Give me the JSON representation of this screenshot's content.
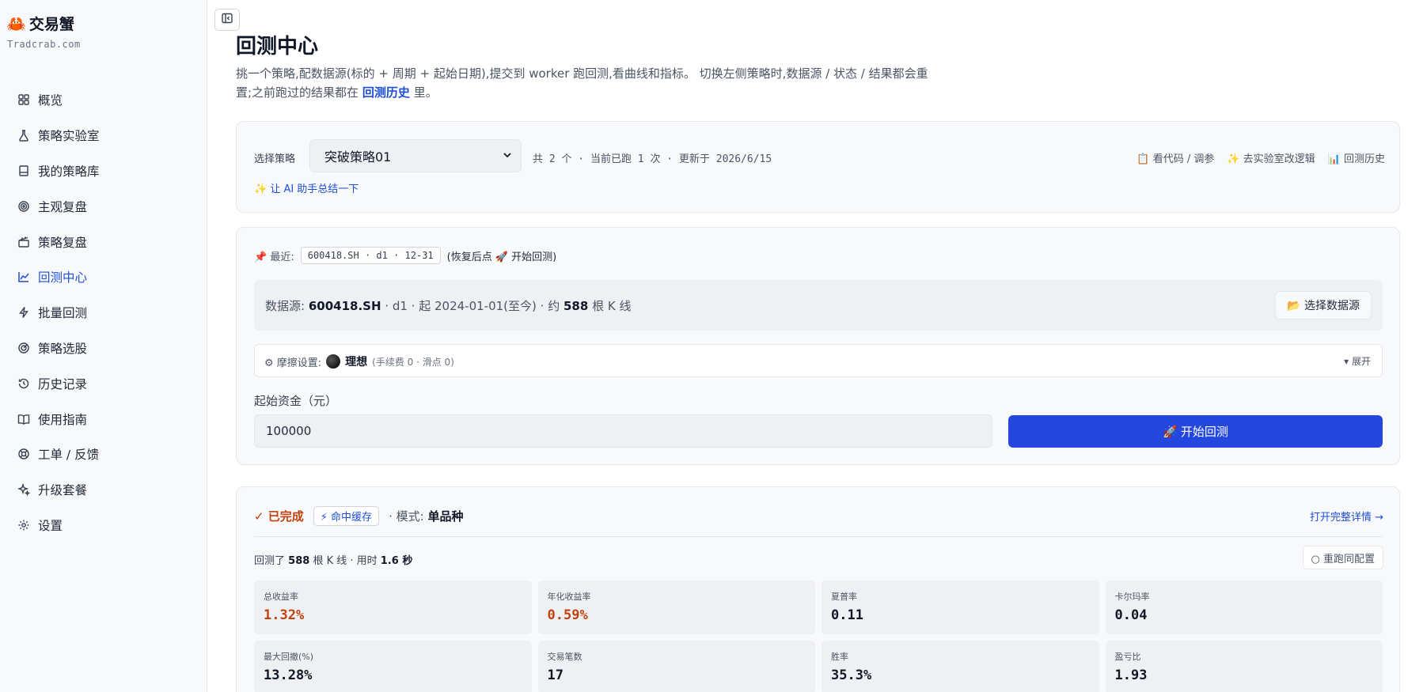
{
  "brand": {
    "logo": "🦀",
    "name": "交易蟹",
    "sub": "Tradcrab.com"
  },
  "nav": [
    {
      "label": "概览",
      "icon": "grid-icon"
    },
    {
      "label": "策略实验室",
      "icon": "flask-icon"
    },
    {
      "label": "我的策略库",
      "icon": "book-icon"
    },
    {
      "label": "主观复盘",
      "icon": "target-icon"
    },
    {
      "label": "策略复盘",
      "icon": "clapper-icon"
    },
    {
      "label": "回测中心",
      "icon": "chart-line-icon",
      "active": true
    },
    {
      "label": "批量回测",
      "icon": "bolt-icon"
    },
    {
      "label": "策略选股",
      "icon": "radar-icon"
    },
    {
      "label": "历史记录",
      "icon": "history-icon"
    },
    {
      "label": "使用指南",
      "icon": "open-book-icon"
    },
    {
      "label": "工单 / 反馈",
      "icon": "lifebuoy-icon"
    },
    {
      "label": "升级套餐",
      "icon": "sparkle-icon"
    },
    {
      "label": "设置",
      "icon": "gear-icon"
    }
  ],
  "header": {
    "title": "回测中心",
    "desc_part1": "挑一个策略,配数据源(标的 + 周期 + 起始日期),提交到 worker 跑回测,看曲线和指标。 切换左侧策略时,数据源 / 状态 / 结果都会重置;之前跑过的结果都在 ",
    "desc_link": "回测历史",
    "desc_part2": " 里。"
  },
  "strategy": {
    "label": "选择策略",
    "selected": "突破策略01",
    "meta": "共 2 个 · 当前已跑 1 次 · 更新于 2026/6/15",
    "links": [
      "📋 看代码 / 调参",
      "✨ 去实验室改逻辑",
      "📊 回测历史"
    ],
    "ai_link": "✨ 让 AI 助手总结一下"
  },
  "recent": {
    "label": "📌 最近:",
    "chip": "600418.SH · d1 · 12-31",
    "hint": "(恢复后点 🚀 开始回测)"
  },
  "datasource": {
    "prefix": "数据源:",
    "symbol": "600418.SH",
    "period": "· d1 ·",
    "start": "起 2024-01-01(至今)",
    "approx": "· 约",
    "bars": "588",
    "suffix": "根 K 线",
    "button": "📂 选择数据源"
  },
  "friction": {
    "label": "⚙ 摩擦设置:",
    "mode": "理想",
    "detail": "(手续费 0 · 滑点 0)",
    "expand": "▾ 展开"
  },
  "capital": {
    "label": "起始资金（元）",
    "value": "100000"
  },
  "start_button": "🚀 开始回测",
  "result": {
    "status": "✓ 已完成",
    "cache": "⚡ 命中缓存",
    "mode_prefix": "· 模式:",
    "mode": "单品种",
    "open_detail": "打开完整详情 →",
    "run_prefix": "回测了",
    "run_bars": "588",
    "run_mid": "根 K 线 · 用时",
    "run_time": "1.6 秒",
    "rerun": "○ 重跑同配置",
    "metrics": [
      {
        "label": "总收益率",
        "value": "1.32%",
        "positive": true
      },
      {
        "label": "年化收益率",
        "value": "0.59%",
        "positive": true
      },
      {
        "label": "夏普率",
        "value": "0.11"
      },
      {
        "label": "卡尔玛率",
        "value": "0.04"
      },
      {
        "label": "最大回撤(%)",
        "value": "13.28%"
      },
      {
        "label": "交易笔数",
        "value": "17"
      },
      {
        "label": "胜率",
        "value": "35.3%"
      },
      {
        "label": "盈亏比",
        "value": "1.93"
      }
    ]
  },
  "colors": {
    "accent": "#2447e0",
    "link": "#1d4ed8",
    "positive": "#c2410c"
  }
}
